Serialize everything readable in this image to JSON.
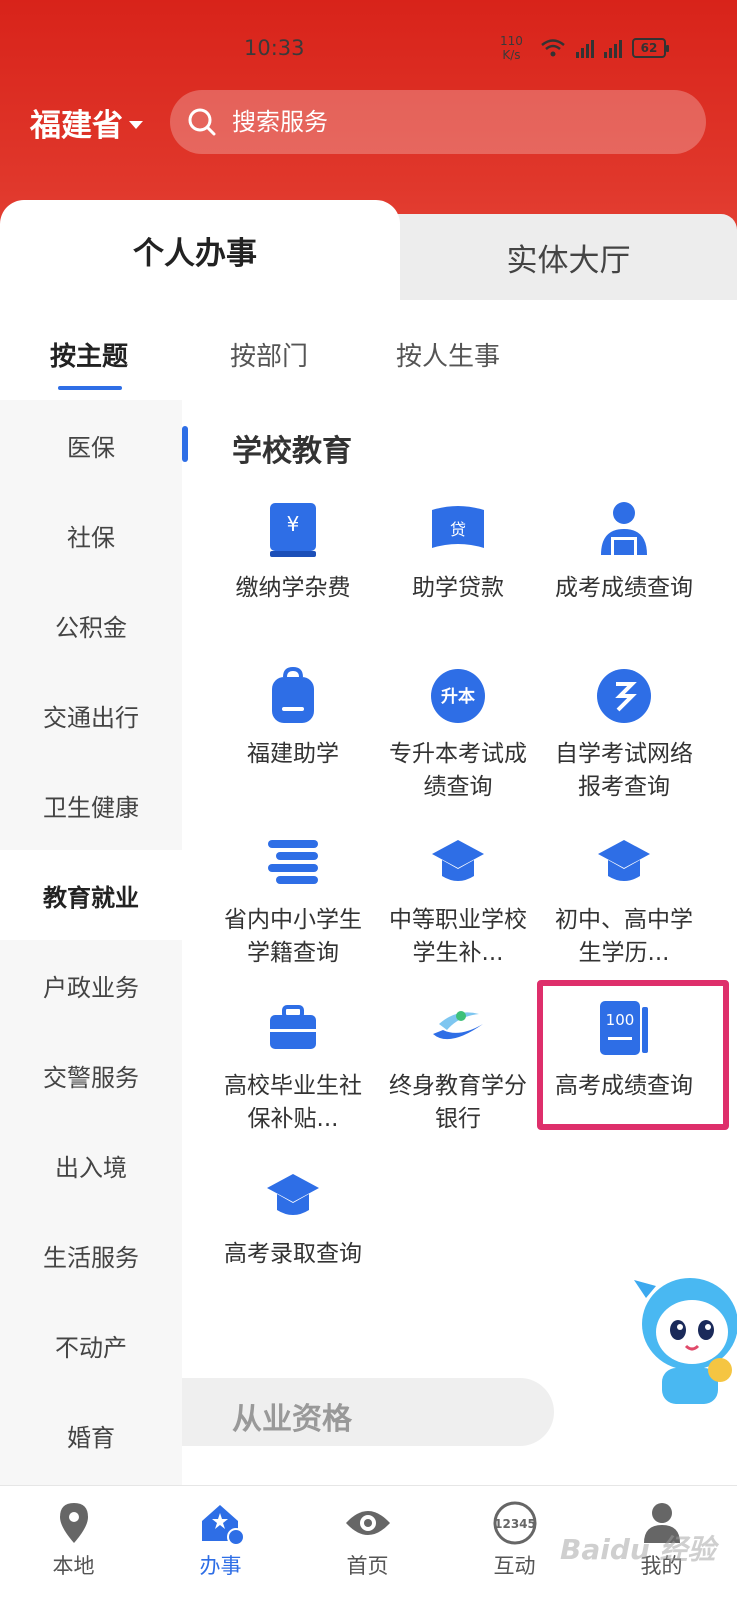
{
  "status_bar": {
    "time": "10:33",
    "net_speed_value": "110",
    "net_speed_unit": "K/s",
    "battery": "62"
  },
  "header": {
    "province": "福建省",
    "search_placeholder": "搜索服务"
  },
  "main_tabs": [
    {
      "label": "个人办事",
      "active": true
    },
    {
      "label": "实体大厅",
      "active": false
    }
  ],
  "sub_tabs": [
    {
      "label": "按主题",
      "active": true
    },
    {
      "label": "按部门"
    },
    {
      "label": "按人生事"
    }
  ],
  "left_nav": [
    {
      "label": "医保"
    },
    {
      "label": "社保"
    },
    {
      "label": "公积金"
    },
    {
      "label": "交通出行"
    },
    {
      "label": "卫生健康"
    },
    {
      "label": "教育就业",
      "active": true
    },
    {
      "label": "户政业务"
    },
    {
      "label": "交警服务"
    },
    {
      "label": "出入境"
    },
    {
      "label": "生活服务"
    },
    {
      "label": "不动产"
    },
    {
      "label": "婚育"
    }
  ],
  "section": {
    "title": "学校教育"
  },
  "services": [
    {
      "label": "缴纳学杂费",
      "icon": "tuition-book-icon"
    },
    {
      "label": "助学贷款",
      "icon": "loan-book-icon"
    },
    {
      "label": "成考成绩查询",
      "icon": "person-desk-icon"
    },
    {
      "label": "福建助学",
      "icon": "backpack-icon"
    },
    {
      "label": "专升本考试成绩查询",
      "icon": "upgrade-badge-icon"
    },
    {
      "label": "自学考试网络报考查询",
      "icon": "self-study-icon"
    },
    {
      "label": "省内中小学生学籍查询",
      "icon": "books-stack-icon"
    },
    {
      "label": "中等职业学校学生补...",
      "icon": "graduation-cap-icon"
    },
    {
      "label": "初中、高中学生学历...",
      "icon": "graduation-cap-icon"
    },
    {
      "label": "高校毕业生社保补贴...",
      "icon": "briefcase-icon"
    },
    {
      "label": "终身教育学分银行",
      "icon": "lifelong-edu-icon"
    },
    {
      "label": "高考成绩查询",
      "icon": "score-book-icon",
      "highlighted": true
    },
    {
      "label": "高考录取查询",
      "icon": "graduation-cap-icon"
    }
  ],
  "section2": {
    "title": "从业资格"
  },
  "bottom_nav": [
    {
      "label": "本地",
      "icon": "location-pin-icon"
    },
    {
      "label": "办事",
      "icon": "service-house-icon",
      "active": true
    },
    {
      "label": "首页",
      "icon": "home-eye-icon"
    },
    {
      "label": "互动",
      "icon": "hotline-12345-icon",
      "badge": "12345"
    },
    {
      "label": "我的",
      "icon": "user-icon"
    }
  ],
  "watermark": "Baidu 经验",
  "colors": {
    "header_red": "#d8231a",
    "accent_blue": "#2e6ee6",
    "highlight_pink": "#de2f6b"
  }
}
